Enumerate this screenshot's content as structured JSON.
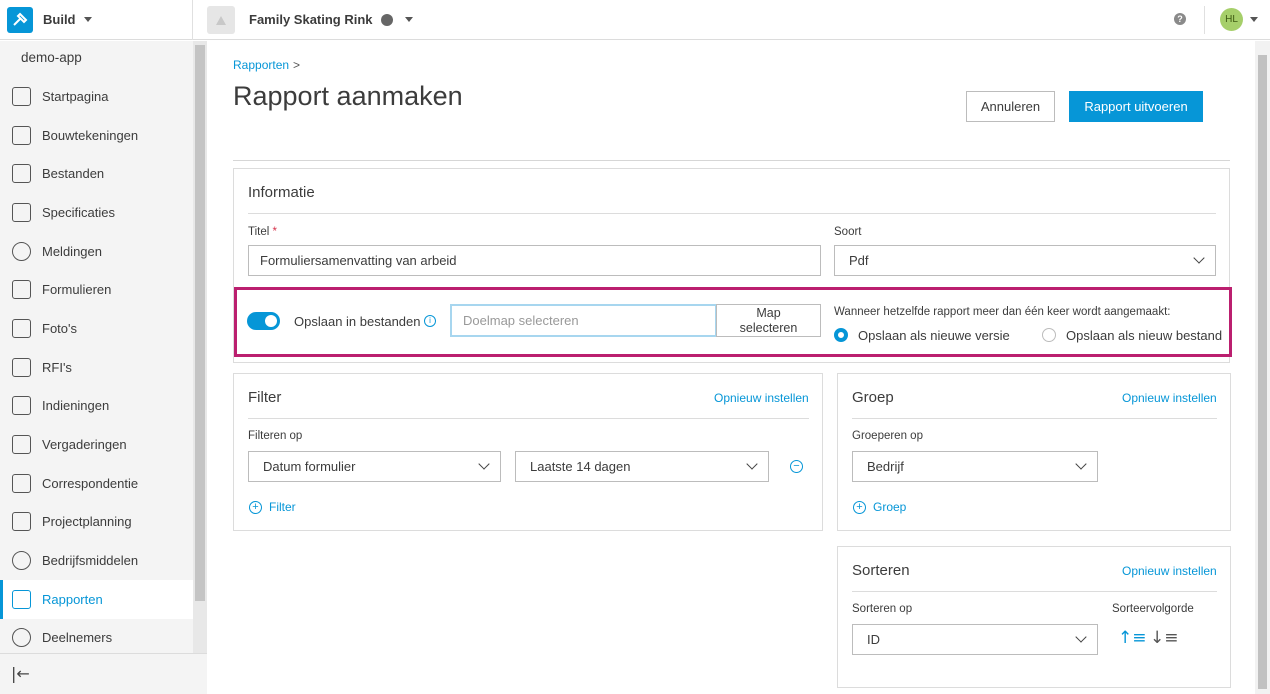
{
  "topbar": {
    "app_name": "Build",
    "project_name": "Family Skating Rink",
    "help": "?",
    "avatar": "HL"
  },
  "sidebar": {
    "app_label": "demo-app",
    "items": [
      {
        "label": "Startpagina",
        "icon": "home-icon"
      },
      {
        "label": "Bouwtekeningen",
        "icon": "sheets-icon"
      },
      {
        "label": "Bestanden",
        "icon": "file-icon"
      },
      {
        "label": "Specificaties",
        "icon": "specifications-icon"
      },
      {
        "label": "Meldingen",
        "icon": "issues-icon"
      },
      {
        "label": "Formulieren",
        "icon": "forms-icon"
      },
      {
        "label": "Foto's",
        "icon": "photos-icon"
      },
      {
        "label": "RFI's",
        "icon": "rfi-icon"
      },
      {
        "label": "Indieningen",
        "icon": "submittals-icon"
      },
      {
        "label": "Vergaderingen",
        "icon": "meetings-icon"
      },
      {
        "label": "Correspondentie",
        "icon": "correspondence-icon"
      },
      {
        "label": "Projectplanning",
        "icon": "schedule-icon"
      },
      {
        "label": "Bedrijfsmiddelen",
        "icon": "assets-icon"
      },
      {
        "label": "Rapporten",
        "icon": "reports-icon",
        "active": true
      },
      {
        "label": "Deelnemers",
        "icon": "members-icon"
      }
    ],
    "collapse": "|←"
  },
  "page": {
    "breadcrumb": "Rapporten",
    "title": "Rapport aanmaken",
    "cancel_label": "Annuleren",
    "run_label": "Rapport uitvoeren"
  },
  "info": {
    "heading": "Informatie",
    "title_label": "Titel",
    "required_mark": "*",
    "title_value": "Formuliersamenvatting van arbeid",
    "type_label": "Soort",
    "type_value": "Pdf",
    "save_label": "Opslaan in bestanden",
    "folder_placeholder": "Doelmap selecteren",
    "folder_button_line1": "Map",
    "folder_button_line2": "selecteren",
    "when_label": "Wanneer hetzelfde rapport meer dan één keer wordt aangemaakt:",
    "radio_new_version": "Opslaan als nieuwe versie",
    "radio_new_file": "Opslaan als nieuw bestand"
  },
  "filter": {
    "heading": "Filter",
    "reset": "Opnieuw instellen",
    "filter_on_label": "Filteren op",
    "field_value": "Datum formulier",
    "range_value": "Laatste 14 dagen",
    "add_label": "Filter"
  },
  "group": {
    "heading": "Groep",
    "reset": "Opnieuw instellen",
    "group_on_label": "Groeperen op",
    "value": "Bedrijf",
    "add_label": "Groep"
  },
  "sort": {
    "heading": "Sorteren",
    "reset": "Opnieuw instellen",
    "sort_on_label": "Sorteren op",
    "value": "ID",
    "order_label": "Sorteervolgorde"
  }
}
